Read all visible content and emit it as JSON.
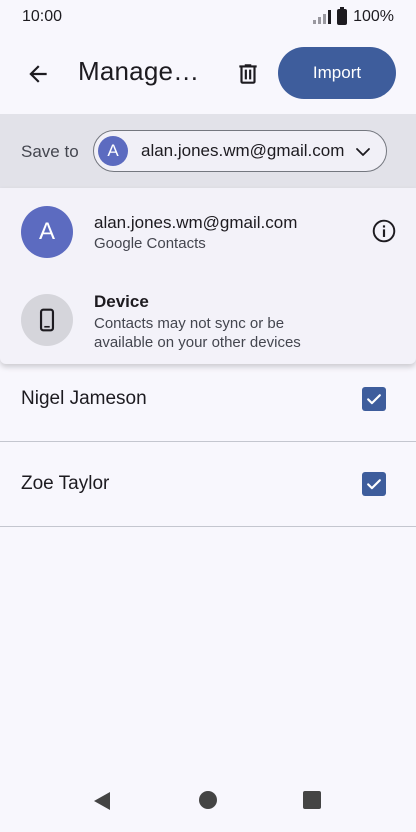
{
  "status_bar": {
    "time": "10:00",
    "battery": "100%"
  },
  "app_bar": {
    "title": "Manage…",
    "import_label": "Import"
  },
  "save_to": {
    "label": "Save to",
    "avatar_letter": "A",
    "selected_account": "alan.jones.wm@gmail.com"
  },
  "dropdown": {
    "items": [
      {
        "avatar_letter": "A",
        "title": "alan.jones.wm@gmail.com",
        "subtitle": "Google Contacts"
      },
      {
        "title": "Device",
        "subtitle_line1": "Contacts may not sync or be",
        "subtitle_line2": "available on your other devices"
      }
    ]
  },
  "contacts": [
    {
      "name": "Nigel Jameson",
      "checked": true
    },
    {
      "name": "Zoe Taylor",
      "checked": true
    }
  ],
  "colors": {
    "accent": "#3e5d9c",
    "avatar": "#5c6bc0",
    "background": "#f8f7fd",
    "save_bar": "#e2e2e9"
  },
  "icons": {
    "back": "arrow-back-icon",
    "delete": "trash-icon",
    "chevron": "chevron-down-icon",
    "info": "info-icon",
    "device": "phone-icon",
    "checkbox": "check-icon"
  }
}
